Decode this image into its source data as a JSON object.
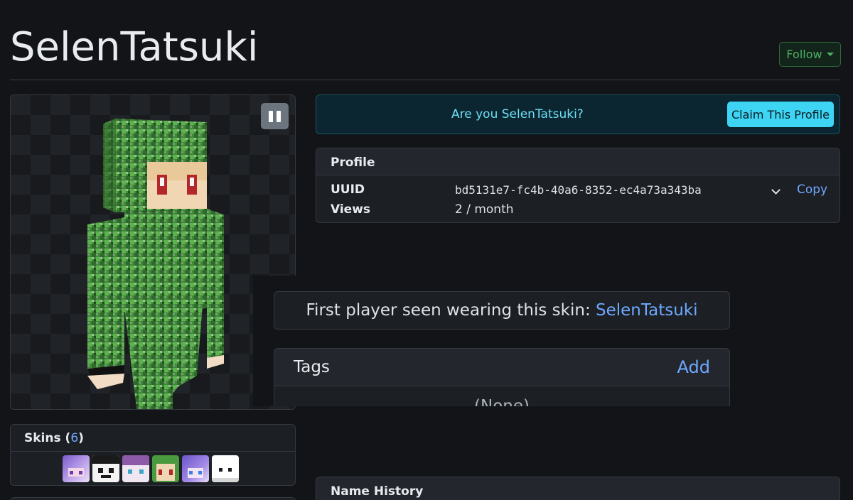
{
  "profile_name": "SelenTatsuki",
  "follow": {
    "label": "Follow"
  },
  "claim": {
    "question": "Are you SelenTatsuki?",
    "button": "Claim This Profile"
  },
  "profile_card": {
    "title": "Profile",
    "uuid_label": "UUID",
    "uuid_value": "bd5131e7-fc4b-40a6-8352-ec4a73a343ba",
    "copy_label": "Copy",
    "views_label": "Views",
    "views_value": "2 / month"
  },
  "first_seen": {
    "prefix": "First player seen wearing this skin: ",
    "player": "SelenTatsuki"
  },
  "tags": {
    "title": "Tags",
    "add_label": "Add",
    "empty_text": "(None)"
  },
  "skins": {
    "title": "Skins",
    "count_open": "(",
    "count": "6",
    "count_close": ")"
  },
  "name_history": {
    "title": "Name History"
  },
  "colors": {
    "accent_link": "#6ea8fe",
    "follow_green": "#4caf62",
    "claim_cyan": "#3dd5f3",
    "background": "#121418"
  },
  "icons": {
    "pause": "pause-icon",
    "caret": "caret-down-icon",
    "chevron": "chevron-down-icon"
  }
}
